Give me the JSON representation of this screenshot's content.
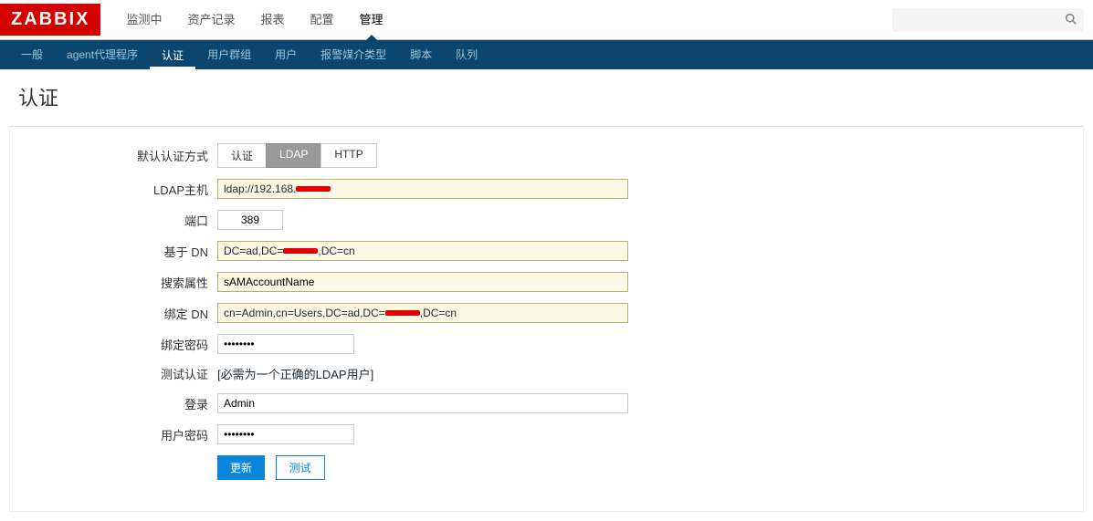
{
  "logo": "ZABBIX",
  "main_nav": {
    "items": [
      {
        "label": "监测中",
        "name": "nav-monitoring"
      },
      {
        "label": "资产记录",
        "name": "nav-inventory"
      },
      {
        "label": "报表",
        "name": "nav-reports"
      },
      {
        "label": "配置",
        "name": "nav-config"
      },
      {
        "label": "管理",
        "name": "nav-admin"
      }
    ],
    "active_index": 4
  },
  "search": {
    "placeholder": ""
  },
  "sub_nav": {
    "items": [
      {
        "label": "一般",
        "name": "subnav-general"
      },
      {
        "label": "agent代理程序",
        "name": "subnav-proxy"
      },
      {
        "label": "认证",
        "name": "subnav-auth"
      },
      {
        "label": "用户群组",
        "name": "subnav-usergroups"
      },
      {
        "label": "用户",
        "name": "subnav-users"
      },
      {
        "label": "报警媒介类型",
        "name": "subnav-mediatypes"
      },
      {
        "label": "脚本",
        "name": "subnav-scripts"
      },
      {
        "label": "队列",
        "name": "subnav-queue"
      }
    ],
    "active_index": 2
  },
  "page": {
    "title": "认证"
  },
  "form": {
    "auth_method_label": "默认认证方式",
    "auth_options": [
      "认证",
      "LDAP",
      "HTTP"
    ],
    "auth_selected": 1,
    "ldap_host_label": "LDAP主机",
    "ldap_host_prefix": "ldap://192.168.",
    "port_label": "端口",
    "port_value": "389",
    "base_dn_label": "基于 DN",
    "base_dn_prefix": "DC=ad,DC=",
    "base_dn_suffix": ",DC=cn",
    "search_attr_label": "搜索属性",
    "search_attr_value": "sAMAccountName",
    "bind_dn_label": "绑定 DN",
    "bind_dn_prefix": "cn=Admin,cn=Users,DC=ad,DC=",
    "bind_dn_suffix": ",DC=cn",
    "bind_pwd_label": "绑定密码",
    "bind_pwd_value": "••••••••",
    "test_auth_label": "测试认证",
    "test_auth_note": "[必需为一个正确的LDAP用户]",
    "login_label": "登录",
    "login_value": "Admin",
    "user_pwd_label": "用户密码",
    "user_pwd_value": "••••••••",
    "btn_update": "更新",
    "btn_test": "测试"
  }
}
